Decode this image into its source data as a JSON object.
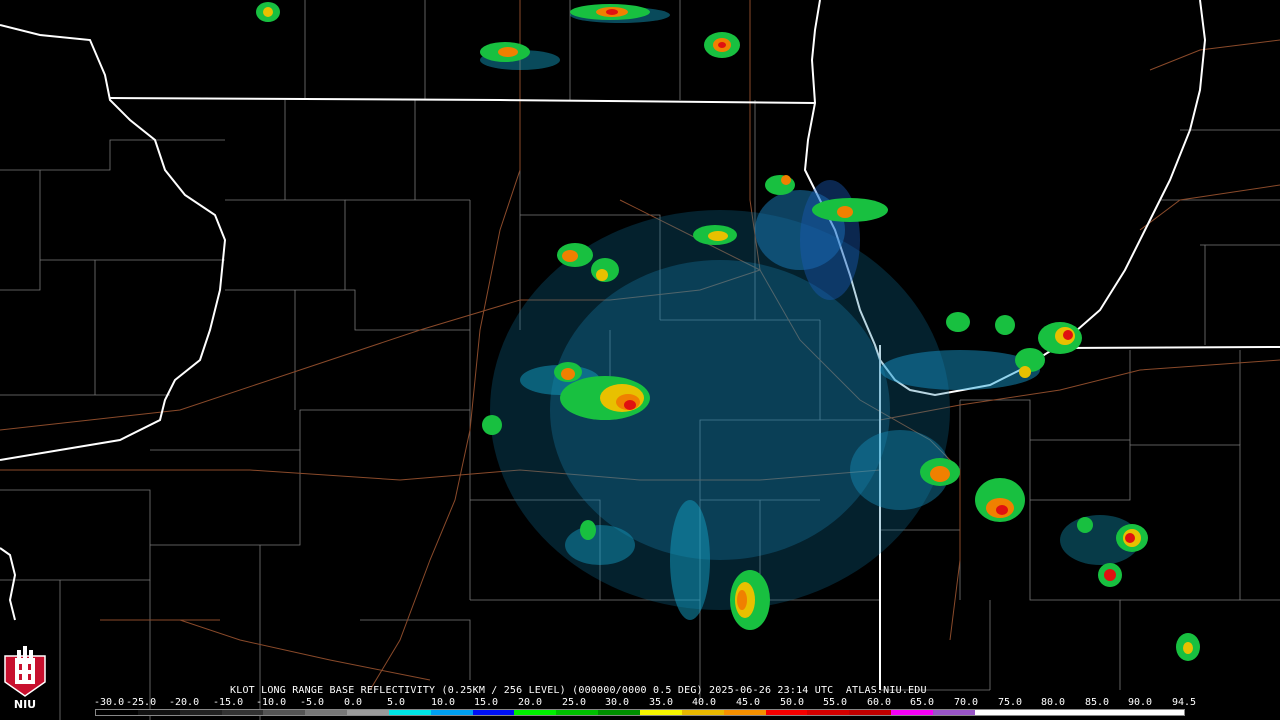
{
  "product": {
    "title": "KLOT LONG RANGE BASE REFLECTIVITY (0.25KM / 256 LEVEL) (000000/0000 0.5 DEG) 2025-06-26 23:14 UTC  ATLAS.NIU.EDU"
  },
  "logo": {
    "text": "NIU"
  },
  "legend": {
    "scale_labels": [
      "-30.0",
      "-25.0",
      "-20.0",
      "-15.0",
      "-10.0",
      "-5.0",
      "0.0",
      "5.0",
      "10.0",
      "15.0",
      "20.0",
      "25.0",
      "30.0",
      "35.0",
      "40.0",
      "45.0",
      "50.0",
      "55.0",
      "60.0",
      "65.0",
      "70.0",
      "75.0",
      "80.0",
      "85.0",
      "90.0",
      "94.5"
    ],
    "colors": [
      "#000000",
      "#111111",
      "#222222",
      "#333333",
      "#555555",
      "#777777",
      "#9a9a9a",
      "#00e5e5",
      "#00a0f0",
      "#0010f5",
      "#00f000",
      "#00c000",
      "#009000",
      "#f5f500",
      "#e7b800",
      "#f59000",
      "#f50000",
      "#d40000",
      "#c00000",
      "#f500f5",
      "#9855c6",
      "#ffffff",
      "#ffffff",
      "#ffffff",
      "#ffffff",
      "#ffffff"
    ]
  }
}
